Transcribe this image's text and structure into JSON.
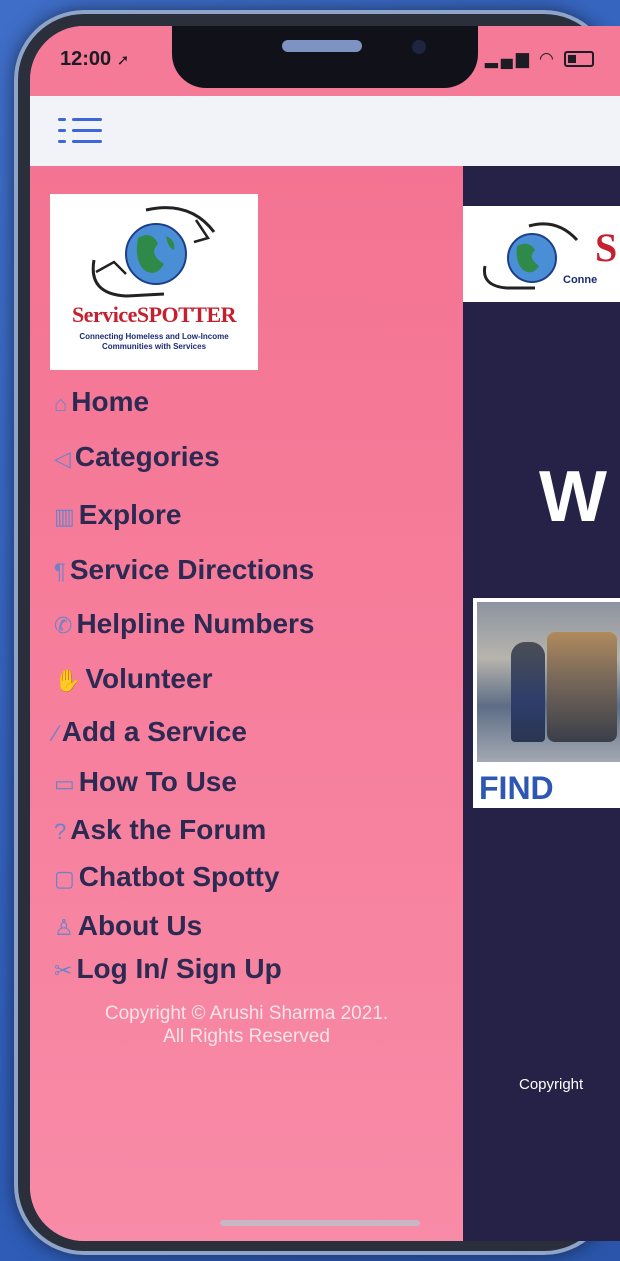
{
  "status_bar": {
    "time": "12:00",
    "location_icon": "location-arrow-icon",
    "signal_icon": "signal-bars-icon",
    "wifi_icon": "wifi-icon",
    "battery_icon": "battery-icon"
  },
  "nav": {
    "menu_icon": "hamburger-menu-icon"
  },
  "drawer": {
    "logo": {
      "title": "ServiceSPOTTER",
      "tagline": "Connecting Homeless and Low-Income Communities with Services"
    },
    "items": [
      {
        "label": "Home",
        "icon": "house-icon",
        "glyph": "⌂"
      },
      {
        "label": "Categories",
        "icon": "paper-plane-icon",
        "glyph": "◁"
      },
      {
        "label": "Explore",
        "icon": "map-icon",
        "glyph": "▥"
      },
      {
        "label": "Service Directions",
        "icon": "pin-icon",
        "glyph": "¶"
      },
      {
        "label": "Helpline Numbers",
        "icon": "phone-icon",
        "glyph": "✆"
      },
      {
        "label": "Volunteer",
        "icon": "hand-icon",
        "glyph": "✋"
      },
      {
        "label": "Add a Service",
        "icon": "pencil-icon",
        "glyph": "⁄"
      },
      {
        "label": "How To Use",
        "icon": "keyboard-icon",
        "glyph": "▭"
      },
      {
        "label": "Ask the Forum",
        "icon": "question-icon",
        "glyph": "?"
      },
      {
        "label": "Chatbot Spotty",
        "icon": "chat-bubbles-icon",
        "glyph": "▢"
      },
      {
        "label": "About Us",
        "icon": "user-icon",
        "glyph": "♙"
      },
      {
        "label": "Log In/ Sign Up",
        "icon": "tools-icon",
        "glyph": "✂"
      }
    ],
    "copyright_line1": "Copyright © Arushi Sharma 2021.",
    "copyright_line2": "All Rights Reserved"
  },
  "main": {
    "logo_letter": "S",
    "logo_sub": "Conne",
    "hero_letter": "W",
    "hero_caption": "FIND",
    "copyright": "Copyright"
  },
  "colors": {
    "drawer_bg": "#f47392",
    "menu_text": "#2c2a52",
    "main_bg": "#252147",
    "accent": "#3d66d6"
  }
}
